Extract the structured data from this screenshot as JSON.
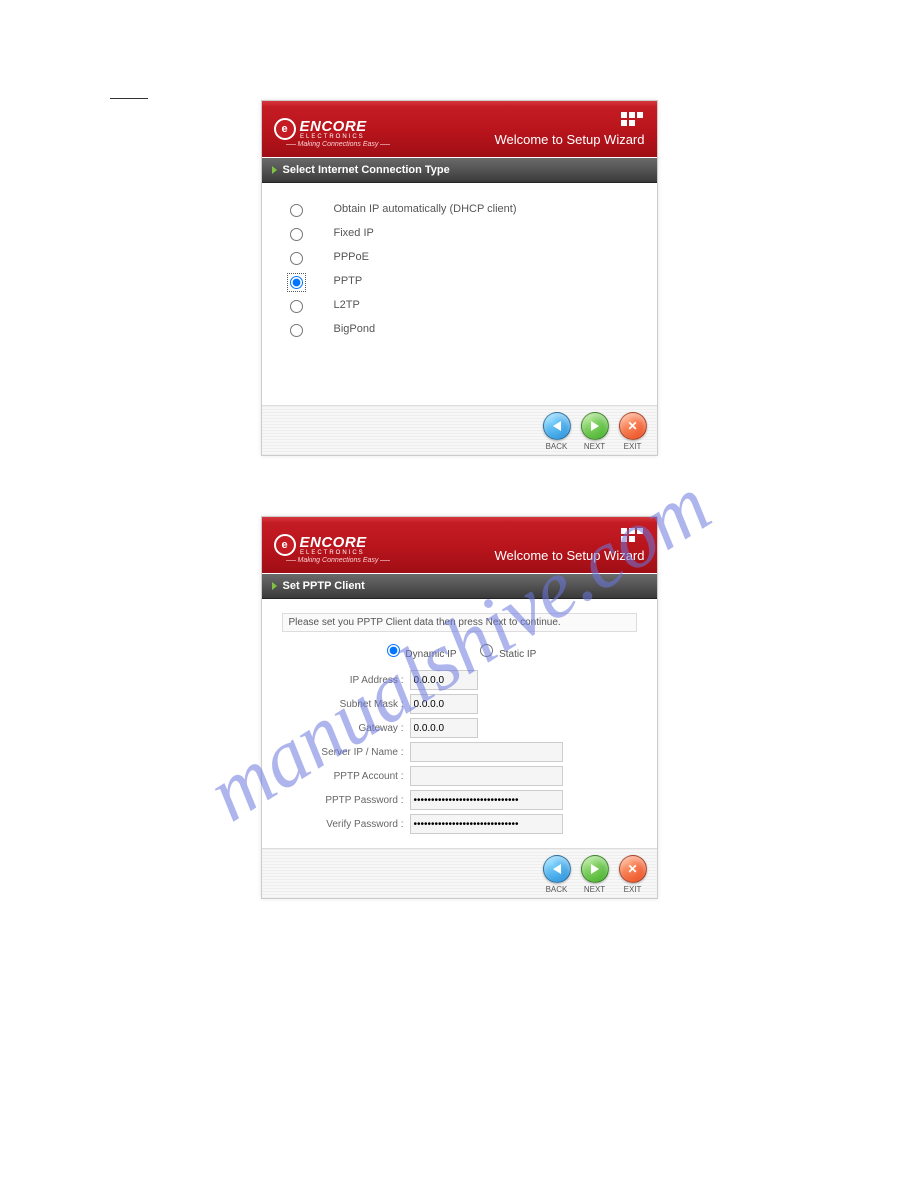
{
  "watermark": "manualshive.com",
  "brand": {
    "main": "ENCORE",
    "sub": "ELECTRONICS",
    "tagline": "Making Connections Easy"
  },
  "header": {
    "welcome": "Welcome to Setup Wizard"
  },
  "panel1": {
    "title": "Select Internet Connection Type",
    "options": {
      "0": "Obtain IP automatically (DHCP client)",
      "1": "Fixed IP",
      "2": "PPPoE",
      "3": "PPTP",
      "4": "L2TP",
      "5": "BigPond"
    },
    "selected_index": 3
  },
  "panel2": {
    "title": "Set PPTP Client",
    "instruction": "Please set you PPTP Client data then press Next to continue.",
    "ip_mode": {
      "dynamic": "Dynamic IP",
      "static": "Static IP",
      "selected": "dynamic"
    },
    "fields": {
      "ip_address": {
        "label": "IP Address :",
        "value": "0.0.0.0"
      },
      "subnet_mask": {
        "label": "Subnet Mask :",
        "value": "0.0.0.0"
      },
      "gateway": {
        "label": "Gateway :",
        "value": "0.0.0.0"
      },
      "server_ip": {
        "label": "Server IP / Name :",
        "value": ""
      },
      "pptp_account": {
        "label": "PPTP Account :",
        "value": ""
      },
      "pptp_password": {
        "label": "PPTP Password :",
        "value": "••••••••••••••••••••••••••••••"
      },
      "verify_password": {
        "label": "Verify Password :",
        "value": "••••••••••••••••••••••••••••••"
      }
    }
  },
  "buttons": {
    "back": "BACK",
    "next": "NEXT",
    "exit": "EXIT"
  }
}
